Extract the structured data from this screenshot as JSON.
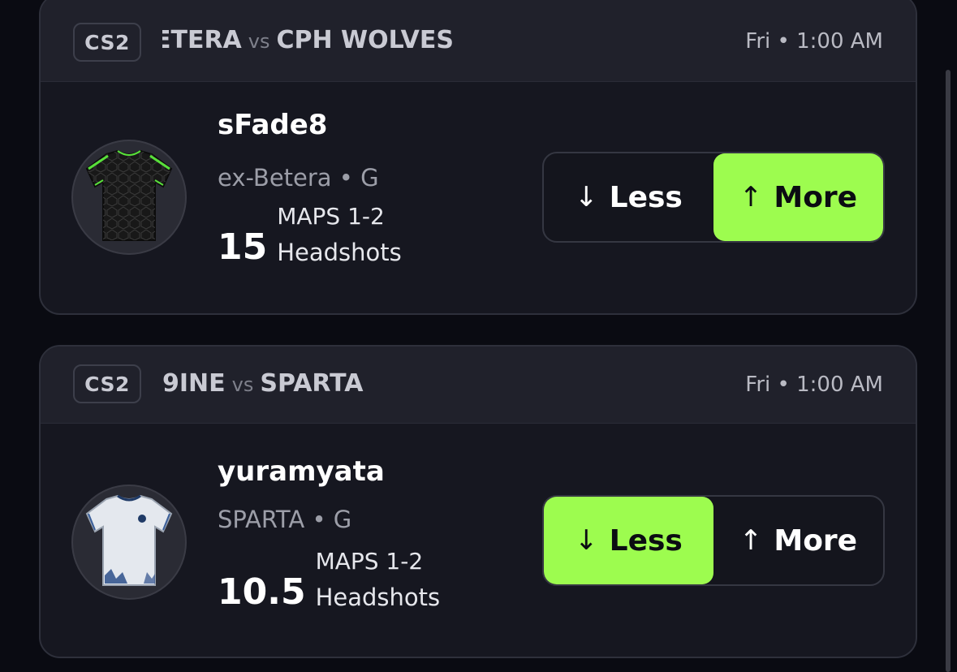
{
  "cards": [
    {
      "game": "CS2",
      "team_a": "ETERA",
      "vs": "vs",
      "team_b": "CPH WOLVES",
      "time": "Fri • 1:00 AM",
      "player": {
        "name": "sFade8",
        "meta": "ex-Betera • G",
        "jersey": "black-green-jersey-icon"
      },
      "stat": {
        "maps": "MAPS 1-2",
        "line": "15",
        "type": "Headshots"
      },
      "buttons": {
        "less": "Less",
        "more": "More",
        "selected": "more"
      }
    },
    {
      "game": "CS2",
      "team_a": "9INE",
      "vs": "vs",
      "team_b": "SPARTA",
      "time": "Fri • 1:00 AM",
      "player": {
        "name": "yuramyata",
        "meta": "SPARTA • G",
        "jersey": "white-jersey-icon"
      },
      "stat": {
        "maps": "MAPS 1-2",
        "line": "10.5",
        "type": "Headshots"
      },
      "buttons": {
        "less": "Less",
        "more": "More",
        "selected": "less"
      }
    }
  ],
  "icons": {
    "arrow_down": "↓",
    "arrow_up": "↑"
  },
  "colors": {
    "accent": "#9dfc4f",
    "card_bg": "#161720",
    "header_bg": "#20212b",
    "page_bg": "#0a0b12"
  }
}
